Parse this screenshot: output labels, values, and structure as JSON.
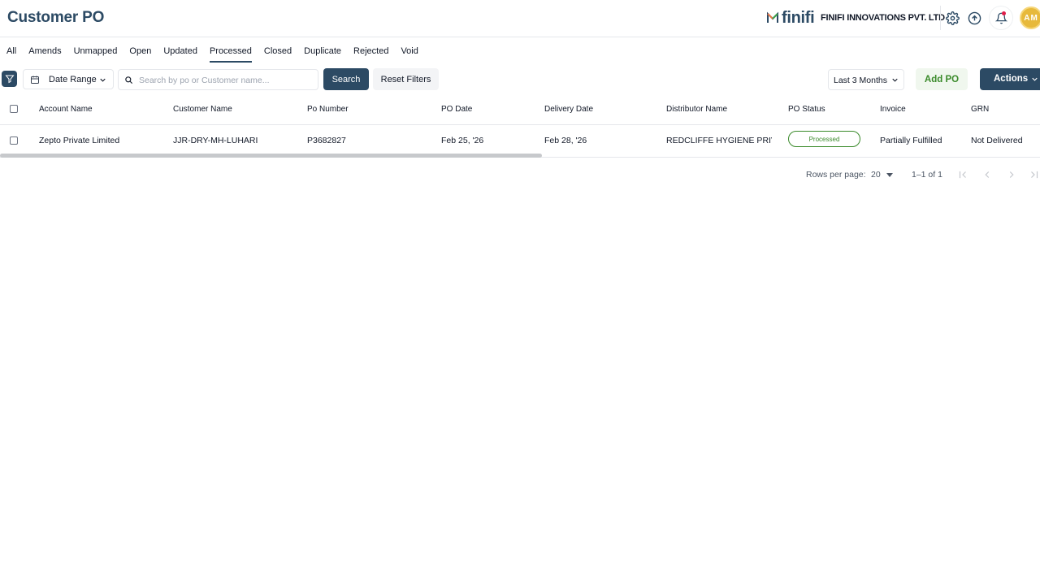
{
  "header": {
    "title": "Customer PO",
    "logo_text": "finifi",
    "company": "FINIFI INNOVATIONS PVT. LTD",
    "avatar_initials": "AM"
  },
  "tabs": [
    {
      "label": "All"
    },
    {
      "label": "Amends"
    },
    {
      "label": "Unmapped"
    },
    {
      "label": "Open"
    },
    {
      "label": "Updated"
    },
    {
      "label": "Processed",
      "active": true
    },
    {
      "label": "Closed"
    },
    {
      "label": "Duplicate"
    },
    {
      "label": "Rejected"
    },
    {
      "label": "Void"
    }
  ],
  "toolbar": {
    "date_range_label": "Date Range",
    "search_placeholder": "Search by po or Customer name...",
    "search_button": "Search",
    "reset_button": "Reset Filters",
    "period": "Last 3 Months",
    "add_button": "Add PO",
    "actions_button": "Actions"
  },
  "table": {
    "columns": [
      "Account Name",
      "Customer Name",
      "Po Number",
      "PO Date",
      "Delivery Date",
      "Distributor Name",
      "PO Status",
      "Invoice",
      "GRN"
    ],
    "rows": [
      {
        "account_name": "Zepto Private Limited",
        "customer_name": "JJR-DRY-MH-LUHARI",
        "po_number": "P3682827",
        "po_date": "Feb 25, '26",
        "delivery_date": "Feb 28, '26",
        "distributor_name": "REDCLIFFE HYGIENE PRIV...",
        "po_status": "Processed",
        "invoice": "Partially Fulfilled",
        "grn": "Not Delivered"
      }
    ]
  },
  "pagination": {
    "rows_per_page_label": "Rows per page:",
    "rows_per_page": "20",
    "range": "1–1 of 1"
  },
  "colors": {
    "primary": "#2c4a64",
    "success": "#3a8a2a",
    "avatar": "#e7b93b"
  }
}
